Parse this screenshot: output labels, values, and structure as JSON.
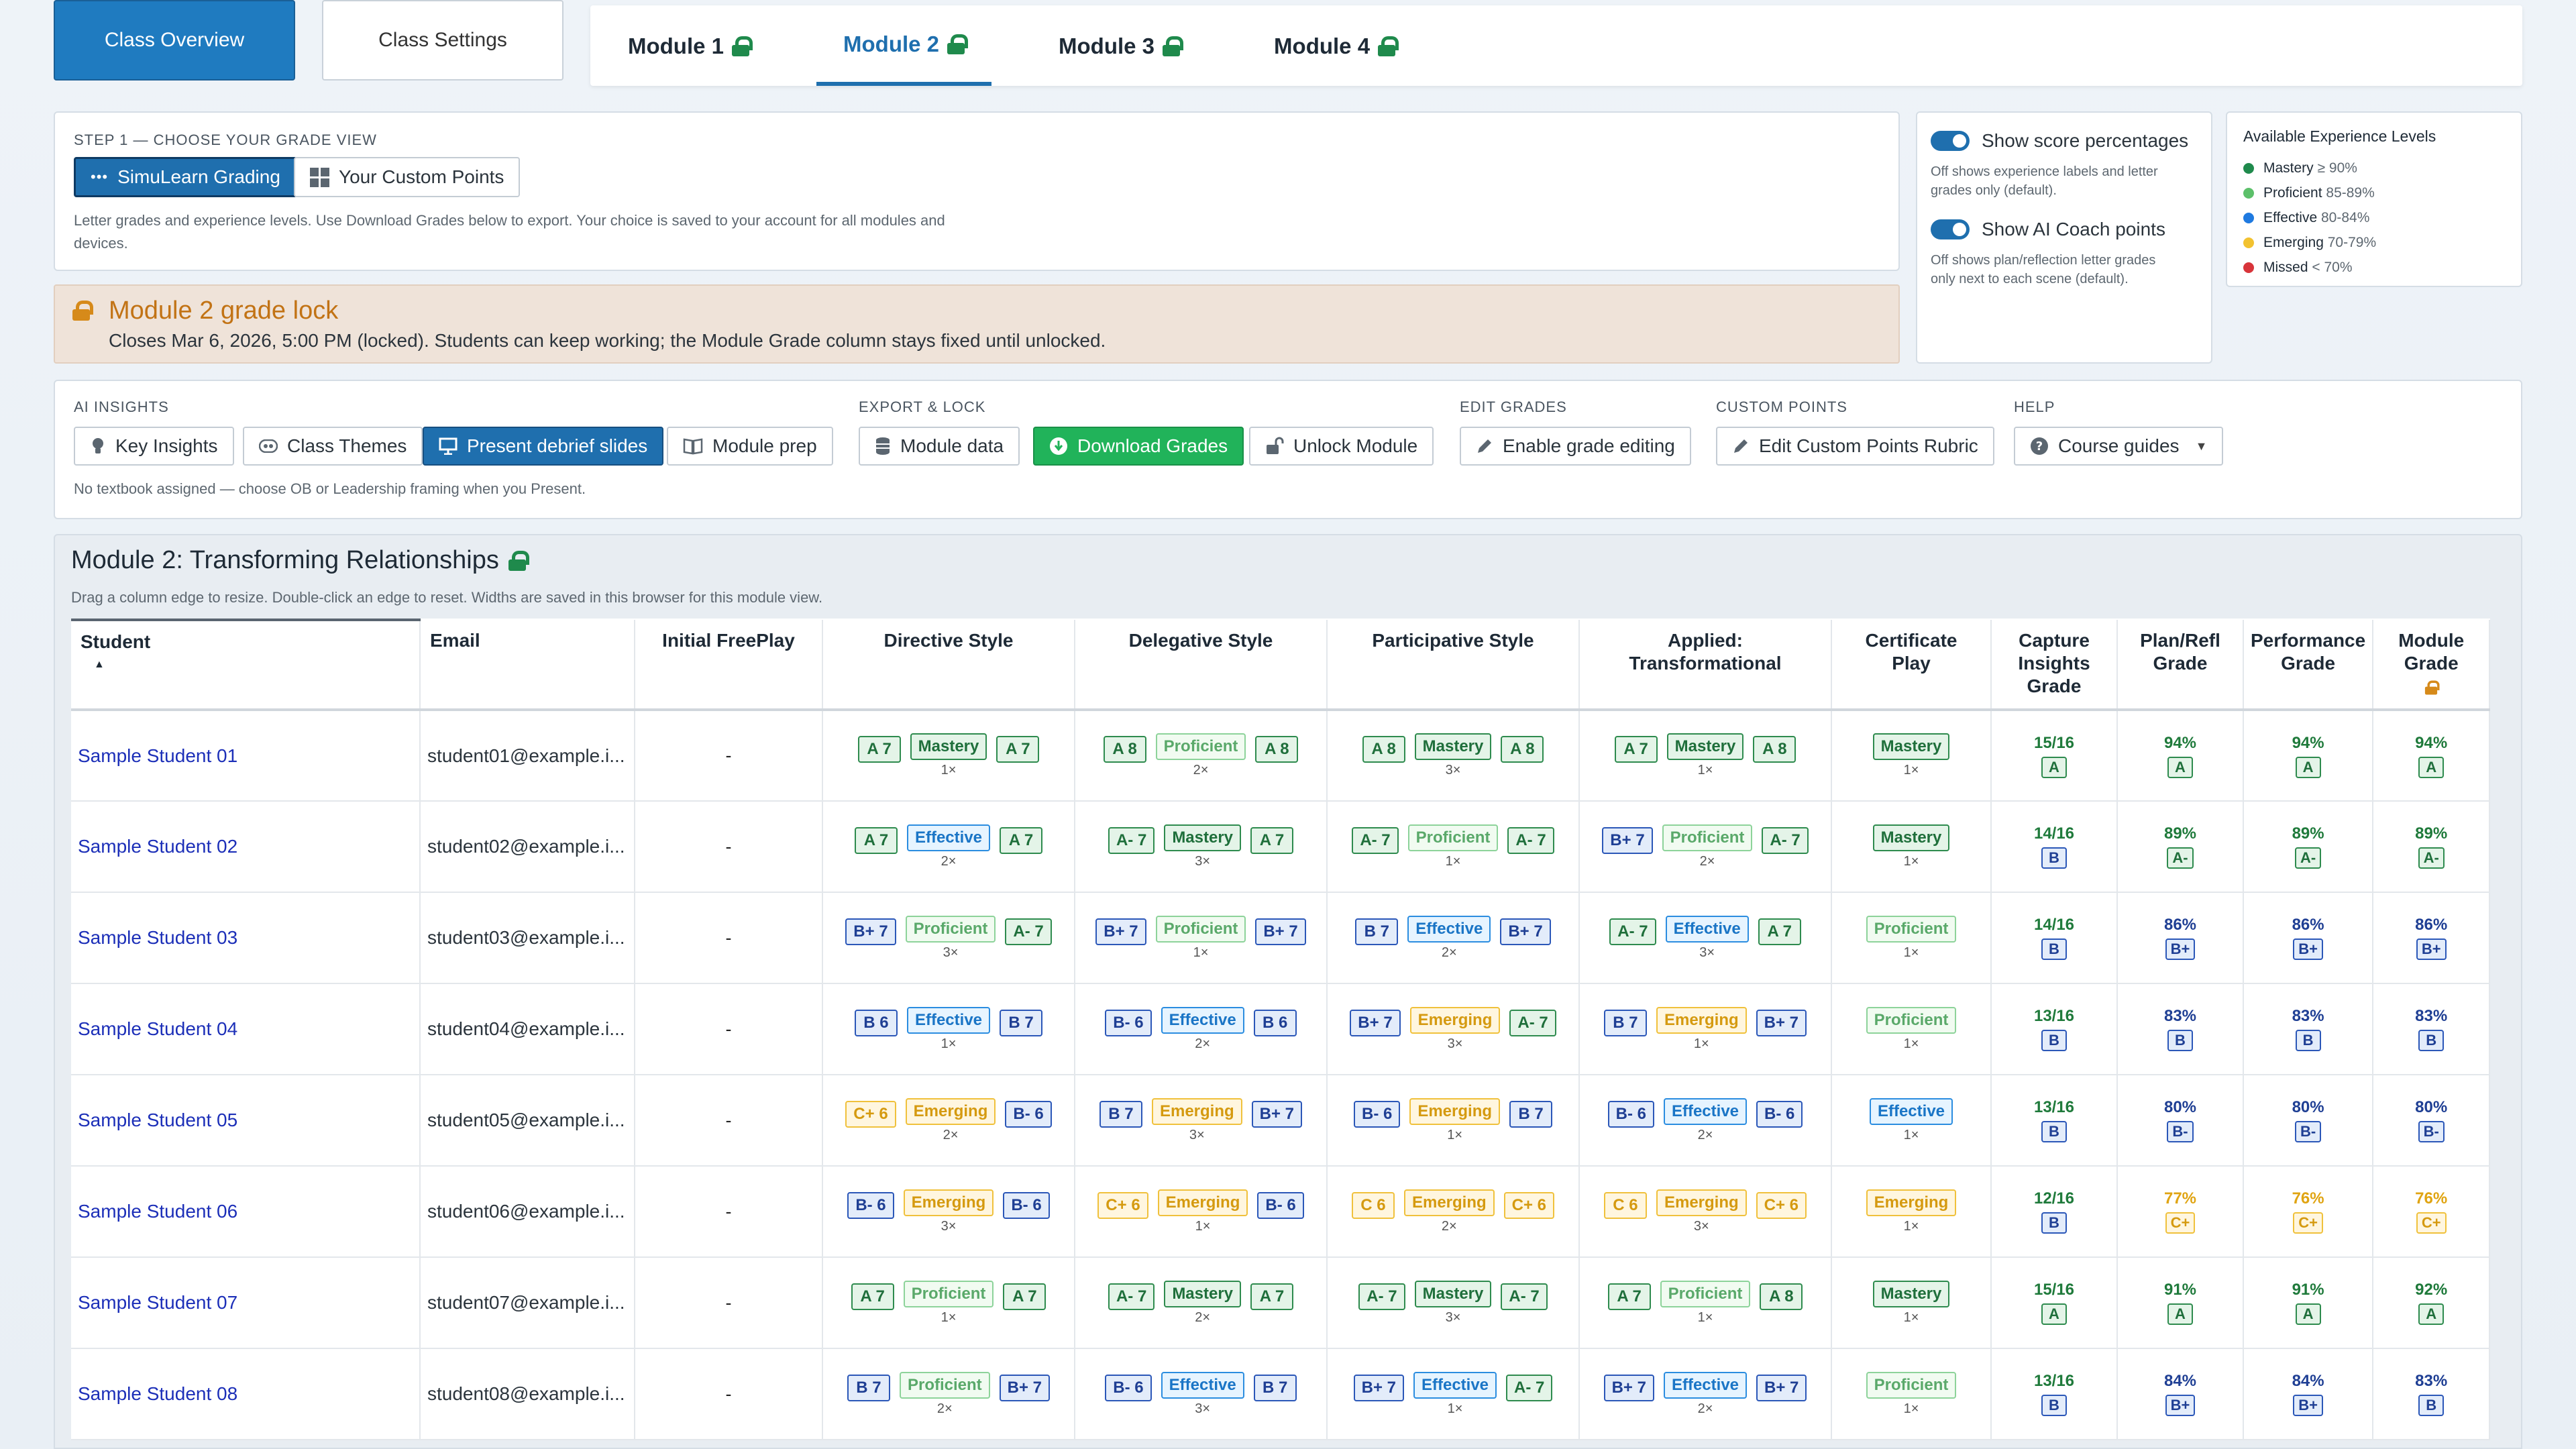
{
  "top_tabs": {
    "overview": "Class Overview",
    "settings": "Class Settings"
  },
  "module_tabs": [
    {
      "label": "Module 1",
      "active": false
    },
    {
      "label": "Module 2",
      "active": true
    },
    {
      "label": "Module 3",
      "active": false
    },
    {
      "label": "Module 4",
      "active": false
    }
  ],
  "grade_view": {
    "step_label": "STEP 1 — CHOOSE YOUR GRADE VIEW",
    "option_simulearn": "SimuLearn Grading",
    "option_custom": "Your Custom Points",
    "help_text_1": "Letter grades and experience levels. Use Download Grades below to export. Your choice is saved to your account for all modules and",
    "help_text_2": "devices."
  },
  "grade_lock": {
    "title": "Module 2 grade lock",
    "message": "Closes Mar 6, 2026, 5:00 PM (locked). Students can keep working; the Module Grade column stays fixed until unlocked."
  },
  "toggles": {
    "score_pct_label": "Show score percentages",
    "score_pct_help_1": "Off shows experience labels and letter",
    "score_pct_help_2": "grades only (default).",
    "ai_coach_label": "Show AI Coach points",
    "ai_coach_help_1": "Off shows plan/reflection letter grades",
    "ai_coach_help_2": "only next to each scene (default)."
  },
  "legend": {
    "title": "Available Experience Levels",
    "items": [
      {
        "name": "Mastery",
        "range": "≥ 90%",
        "color": "#1f8a4c"
      },
      {
        "name": "Proficient",
        "range": "85-89%",
        "color": "#5cc06a"
      },
      {
        "name": "Effective",
        "range": "80-84%",
        "color": "#1f7ae0"
      },
      {
        "name": "Emerging",
        "range": "70-79%",
        "color": "#f2c230"
      },
      {
        "name": "Missed",
        "range": "< 70%",
        "color": "#d8343a"
      }
    ]
  },
  "toolbar": {
    "ai_insights": "AI INSIGHTS",
    "key_insights": "Key Insights",
    "class_themes": "Class Themes",
    "present_debrief": "Present debrief slides",
    "module_prep": "Module prep",
    "export_lock": "EXPORT & LOCK",
    "module_data": "Module data",
    "download_grades": "Download Grades",
    "unlock_module": "Unlock Module",
    "edit_grades": "EDIT GRADES",
    "enable_editing": "Enable grade editing",
    "custom_points": "CUSTOM POINTS",
    "edit_rubric": "Edit Custom Points Rubric",
    "help": "HELP",
    "course_guides": "Course guides",
    "note": "No textbook assigned — choose OB or Leadership framing when you Present."
  },
  "grade_table": {
    "title": "Module 2: Transforming Relationships",
    "subtitle": "Drag a column edge to resize. Double-click an edge to reset. Widths are saved in this browser for this module view.",
    "columns": [
      "Student",
      "Email",
      "Initial FreePlay",
      "Directive Style",
      "Delegative Style",
      "Participative Style",
      "Applied: Transformational",
      "Certificate Play",
      "Capture Insights Grade",
      "Plan/Refl Grade",
      "Performance Grade",
      "Module Grade"
    ],
    "sort_indicator": "▲",
    "rows": [
      {
        "name": "Sample Student 01",
        "email": "student01@example.i...",
        "freeplay": "-",
        "scenes": [
          [
            "A 7",
            "Mastery",
            "A 7",
            "1×"
          ],
          [
            "A 8",
            "Proficient",
            "A 8",
            "2×"
          ],
          [
            "A 8",
            "Mastery",
            "A 8",
            "3×"
          ],
          [
            "A 7",
            "Mastery",
            "A 8",
            "1×"
          ]
        ],
        "cert": [
          "Mastery",
          "1×"
        ],
        "capture": [
          "15/16",
          "A"
        ],
        "plan": [
          "94%",
          "A"
        ],
        "perf": [
          "94%",
          "A"
        ],
        "module": [
          "94%",
          "A"
        ]
      },
      {
        "name": "Sample Student 02",
        "email": "student02@example.i...",
        "freeplay": "-",
        "scenes": [
          [
            "A 7",
            "Effective",
            "A 7",
            "2×"
          ],
          [
            "A- 7",
            "Mastery",
            "A 7",
            "3×"
          ],
          [
            "A- 7",
            "Proficient",
            "A- 7",
            "1×"
          ],
          [
            "B+ 7",
            "Proficient",
            "A- 7",
            "2×"
          ]
        ],
        "cert": [
          "Mastery",
          "1×"
        ],
        "capture": [
          "14/16",
          "B"
        ],
        "plan": [
          "89%",
          "A-"
        ],
        "perf": [
          "89%",
          "A-"
        ],
        "module": [
          "89%",
          "A-"
        ]
      },
      {
        "name": "Sample Student 03",
        "email": "student03@example.i...",
        "freeplay": "-",
        "scenes": [
          [
            "B+ 7",
            "Proficient",
            "A- 7",
            "3×"
          ],
          [
            "B+ 7",
            "Proficient",
            "B+ 7",
            "1×"
          ],
          [
            "B 7",
            "Effective",
            "B+ 7",
            "2×"
          ],
          [
            "A- 7",
            "Effective",
            "A 7",
            "3×"
          ]
        ],
        "cert": [
          "Proficient",
          "1×"
        ],
        "capture": [
          "14/16",
          "B"
        ],
        "plan": [
          "86%",
          "B+"
        ],
        "perf": [
          "86%",
          "B+"
        ],
        "module": [
          "86%",
          "B+"
        ]
      },
      {
        "name": "Sample Student 04",
        "email": "student04@example.i...",
        "freeplay": "-",
        "scenes": [
          [
            "B 6",
            "Effective",
            "B 7",
            "1×"
          ],
          [
            "B- 6",
            "Effective",
            "B 6",
            "2×"
          ],
          [
            "B+ 7",
            "Emerging",
            "A- 7",
            "3×"
          ],
          [
            "B 7",
            "Emerging",
            "B+ 7",
            "1×"
          ]
        ],
        "cert": [
          "Proficient",
          "1×"
        ],
        "capture": [
          "13/16",
          "B"
        ],
        "plan": [
          "83%",
          "B"
        ],
        "perf": [
          "83%",
          "B"
        ],
        "module": [
          "83%",
          "B"
        ]
      },
      {
        "name": "Sample Student 05",
        "email": "student05@example.i...",
        "freeplay": "-",
        "scenes": [
          [
            "C+ 6",
            "Emerging",
            "B- 6",
            "2×"
          ],
          [
            "B 7",
            "Emerging",
            "B+ 7",
            "3×"
          ],
          [
            "B- 6",
            "Emerging",
            "B 7",
            "1×"
          ],
          [
            "B- 6",
            "Effective",
            "B- 6",
            "2×"
          ]
        ],
        "cert": [
          "Effective",
          "1×"
        ],
        "capture": [
          "13/16",
          "B"
        ],
        "plan": [
          "80%",
          "B-"
        ],
        "perf": [
          "80%",
          "B-"
        ],
        "module": [
          "80%",
          "B-"
        ]
      },
      {
        "name": "Sample Student 06",
        "email": "student06@example.i...",
        "freeplay": "-",
        "scenes": [
          [
            "B- 6",
            "Emerging",
            "B- 6",
            "3×"
          ],
          [
            "C+ 6",
            "Emerging",
            "B- 6",
            "1×"
          ],
          [
            "C 6",
            "Emerging",
            "C+ 6",
            "2×"
          ],
          [
            "C 6",
            "Emerging",
            "C+ 6",
            "3×"
          ]
        ],
        "cert": [
          "Emerging",
          "1×"
        ],
        "capture": [
          "12/16",
          "B"
        ],
        "plan": [
          "77%",
          "C+"
        ],
        "perf": [
          "76%",
          "C+"
        ],
        "module": [
          "76%",
          "C+"
        ]
      },
      {
        "name": "Sample Student 07",
        "email": "student07@example.i...",
        "freeplay": "-",
        "scenes": [
          [
            "A 7",
            "Proficient",
            "A 7",
            "1×"
          ],
          [
            "A- 7",
            "Mastery",
            "A 7",
            "2×"
          ],
          [
            "A- 7",
            "Mastery",
            "A- 7",
            "3×"
          ],
          [
            "A 7",
            "Proficient",
            "A 8",
            "1×"
          ]
        ],
        "cert": [
          "Mastery",
          "1×"
        ],
        "capture": [
          "15/16",
          "A"
        ],
        "plan": [
          "91%",
          "A"
        ],
        "perf": [
          "91%",
          "A"
        ],
        "module": [
          "92%",
          "A"
        ]
      },
      {
        "name": "Sample Student 08",
        "email": "student08@example.i...",
        "freeplay": "-",
        "scenes": [
          [
            "B 7",
            "Proficient",
            "B+ 7",
            "2×"
          ],
          [
            "B- 6",
            "Effective",
            "B 7",
            "3×"
          ],
          [
            "B+ 7",
            "Effective",
            "A- 7",
            "1×"
          ],
          [
            "B+ 7",
            "Effective",
            "B+ 7",
            "2×"
          ]
        ],
        "cert": [
          "Proficient",
          "1×"
        ],
        "capture": [
          "13/16",
          "B"
        ],
        "plan": [
          "84%",
          "B+"
        ],
        "perf": [
          "84%",
          "B+"
        ],
        "module": [
          "83%",
          "B"
        ]
      }
    ]
  }
}
